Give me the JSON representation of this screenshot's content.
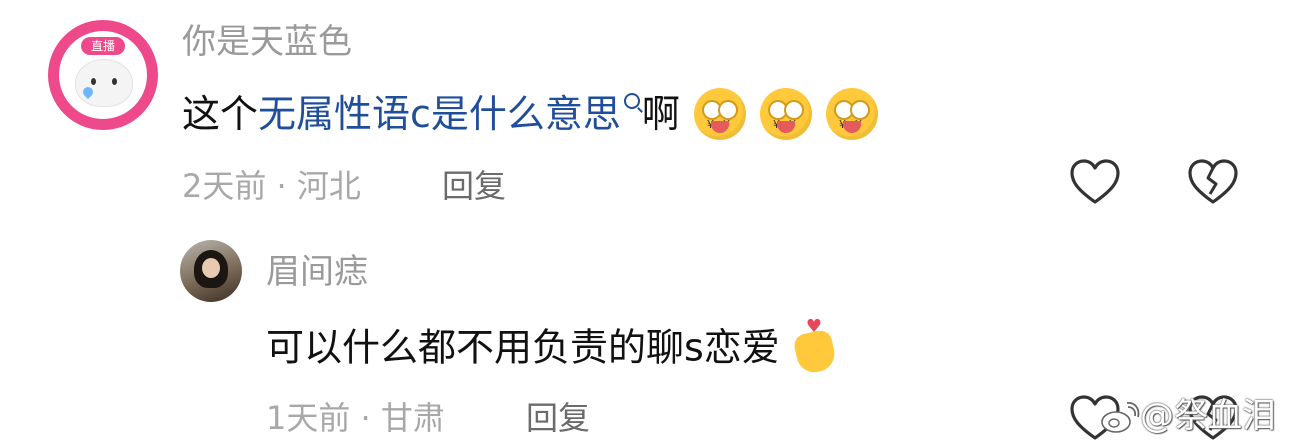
{
  "comments": [
    {
      "username": "你是天蓝色",
      "avatar_badge": "直播",
      "text_before": "这个",
      "keyword": "无属性语c是什么意思",
      "text_after": "啊",
      "emoji_icons": [
        "money-eyes-emoji",
        "money-eyes-emoji",
        "money-eyes-emoji"
      ],
      "meta": "2天前 · 河北",
      "reply_label": "回复"
    },
    {
      "username": "眉间痣",
      "text": "可以什么都不用负责的聊s恋爱",
      "emoji_icon": "finger-heart-emoji",
      "meta": "1天前 · 甘肃",
      "reply_label": "回复"
    }
  ],
  "watermark": "@祭血泪",
  "colors": {
    "keyword": "#1f4e9a",
    "avatar_ring": "#ee4a8b",
    "meta": "#a8a8a8"
  }
}
